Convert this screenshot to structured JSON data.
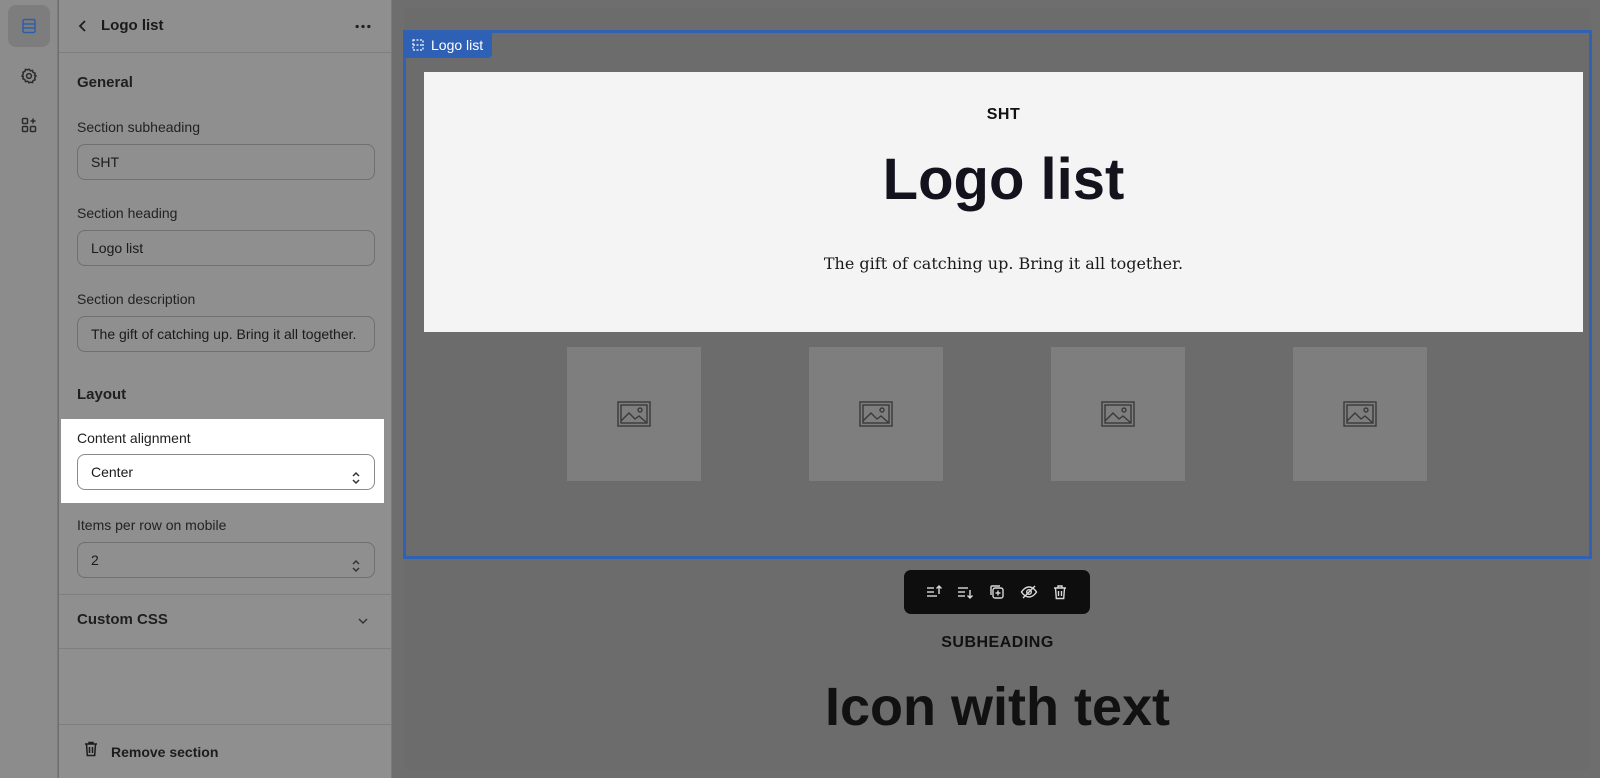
{
  "rail": {
    "icons": [
      "sections-icon",
      "settings-gear-icon",
      "apps-icon"
    ],
    "active": "sections-icon"
  },
  "panel": {
    "title": "Logo list",
    "general": {
      "title": "General",
      "subheading_label": "Section subheading",
      "subheading_value": "SHT",
      "heading_label": "Section heading",
      "heading_value": "Logo list",
      "description_label": "Section description",
      "description_value": "The gift of catching up. Bring it all together."
    },
    "layout": {
      "title": "Layout",
      "alignment_label": "Content alignment",
      "alignment_value": "Center",
      "items_label": "Items per row on mobile",
      "items_value": "2"
    },
    "custom_css": {
      "title": "Custom CSS"
    },
    "remove_label": "Remove section"
  },
  "preview": {
    "selected_tag": "Logo list",
    "hero": {
      "subheading": "SHT",
      "heading": "Logo list",
      "description": "The gift of catching up. Bring it all together."
    },
    "logo_count": 4,
    "toolbar": [
      "move-up-icon",
      "move-down-icon",
      "duplicate-icon",
      "hide-icon",
      "delete-icon"
    ],
    "next_section": {
      "subheading": "SUBHEADING",
      "heading": "Icon with text"
    }
  },
  "colors": {
    "accent": "#2f62b4",
    "overlay_dim": "#6e6e6e",
    "toolbar_bg": "#0e0e0e"
  }
}
